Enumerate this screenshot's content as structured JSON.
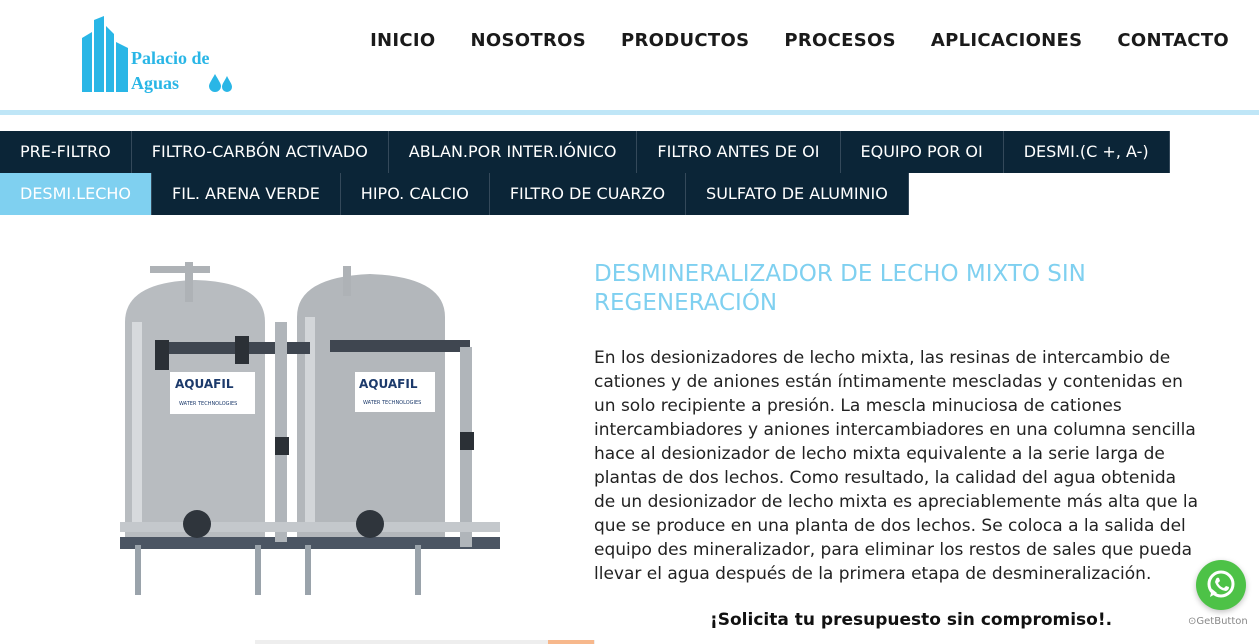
{
  "logo": {
    "line1": "Palacio de",
    "line2": "Aguas"
  },
  "nav": [
    {
      "label": "INICIO"
    },
    {
      "label": "NOSOTROS"
    },
    {
      "label": "PRODUCTOS"
    },
    {
      "label": "PROCESOS"
    },
    {
      "label": "APLICACIONES"
    },
    {
      "label": "CONTACTO"
    }
  ],
  "tabs_row1": [
    {
      "label": "PRE-FILTRO"
    },
    {
      "label": "FILTRO-CARBÓN ACTIVADO"
    },
    {
      "label": "ABLAN.POR INTER.IÓNICO"
    },
    {
      "label": "FILTRO ANTES DE OI"
    },
    {
      "label": "EQUIPO POR OI"
    },
    {
      "label": "DESMI.(C +, A-)"
    }
  ],
  "tabs_row2": [
    {
      "label": "DESMI.LECHO",
      "active": true
    },
    {
      "label": "FIL. ARENA VERDE"
    },
    {
      "label": "HIPO. CALCIO"
    },
    {
      "label": "FILTRO DE CUARZO"
    },
    {
      "label": "SULFATO DE ALUMINIO"
    }
  ],
  "product": {
    "title": "DESMINERALIZADOR DE LECHO MIXTO SIN REGENERACIÓN",
    "description": "En los desionizadores de lecho mixta, las resinas de intercambio de cationes y de aniones están íntimamente mescladas y contenidas en un solo recipiente a presión. La mescla minuciosa de cationes intercambiadores y aniones intercambiadores en una columna sencilla hace al desionizador de lecho mixta equivalente a la serie larga de plantas de dos lechos. Como resultado, la calidad del agua obtenida de un desionizador de lecho mixta es apreciablemente más alta que la que se produce en una planta de dos lechos. Se coloca a la salida del equipo des mineralizador, para eliminar los restos de sales que pueda llevar el agua después de la primera etapa de desmineralización.",
    "tank_brand": "AQUAFIL",
    "tank_subtitle": "WATER TECHNOLOGIES"
  },
  "cta": "¡Solicita tu presupuesto sin compromiso!.",
  "widget": {
    "getbutton": "GetButton"
  },
  "colors": {
    "accent": "#7fd0f0",
    "tab_bg": "#0b2537",
    "whatsapp": "#4dc247",
    "logo": "#29b6e6"
  }
}
